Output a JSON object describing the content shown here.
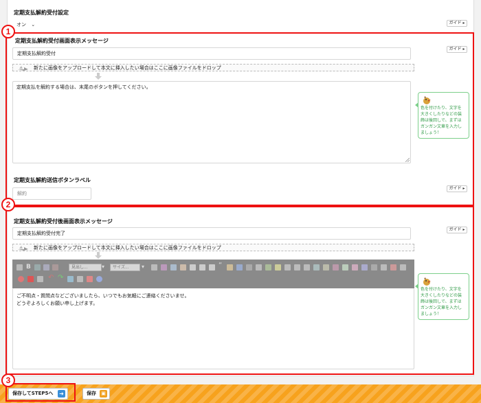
{
  "section1": {
    "title": "定期支払解約受付設定",
    "select_value": "オン"
  },
  "guide_label": "ガイド",
  "message_section": {
    "title": "定期支払解約受付画面表示メッセージ",
    "input_value": "定期支払解約受付",
    "drop_text": "新たに画像をアップロードして本文に挿入したい場合はここに画像ファイルをドロップ",
    "body_text": "定期支払を解約する場合は、末尾のボタンを押してください。"
  },
  "button_label_section": {
    "title": "定期支払解約送信ボタンラベル",
    "input_placeholder": "解約"
  },
  "after_section": {
    "title": "定期支払解約受付後画面表示メッセージ",
    "input_value": "定期支払解約受付完了",
    "drop_text": "新たに画像をアップロードして本文に挿入したい場合はここに画像ファイルをドロップ",
    "toolbar_heading_select": "見出し...",
    "toolbar_size_select": "サイズ...",
    "body_line1": "ご不明点・質問点などございましたら、いつでもお気軽にご連絡くださいませ。",
    "body_line2": "どうぞよろしくお願い申し上げます。"
  },
  "tip": {
    "lines": [
      "色を付けたり、文字を",
      "大きくしたりなどの装",
      "飾は後回しで、まずは",
      "ガンガン文章を入力し",
      "ましょう！"
    ]
  },
  "markers": [
    "1",
    "2",
    "3"
  ],
  "footer": {
    "save_next_label": "保存してSTEP5へ",
    "save_label": "保存"
  },
  "colors": {
    "highlight": "#e11111",
    "footer": "#f7a21d",
    "tip_green": "#2e9a45"
  }
}
